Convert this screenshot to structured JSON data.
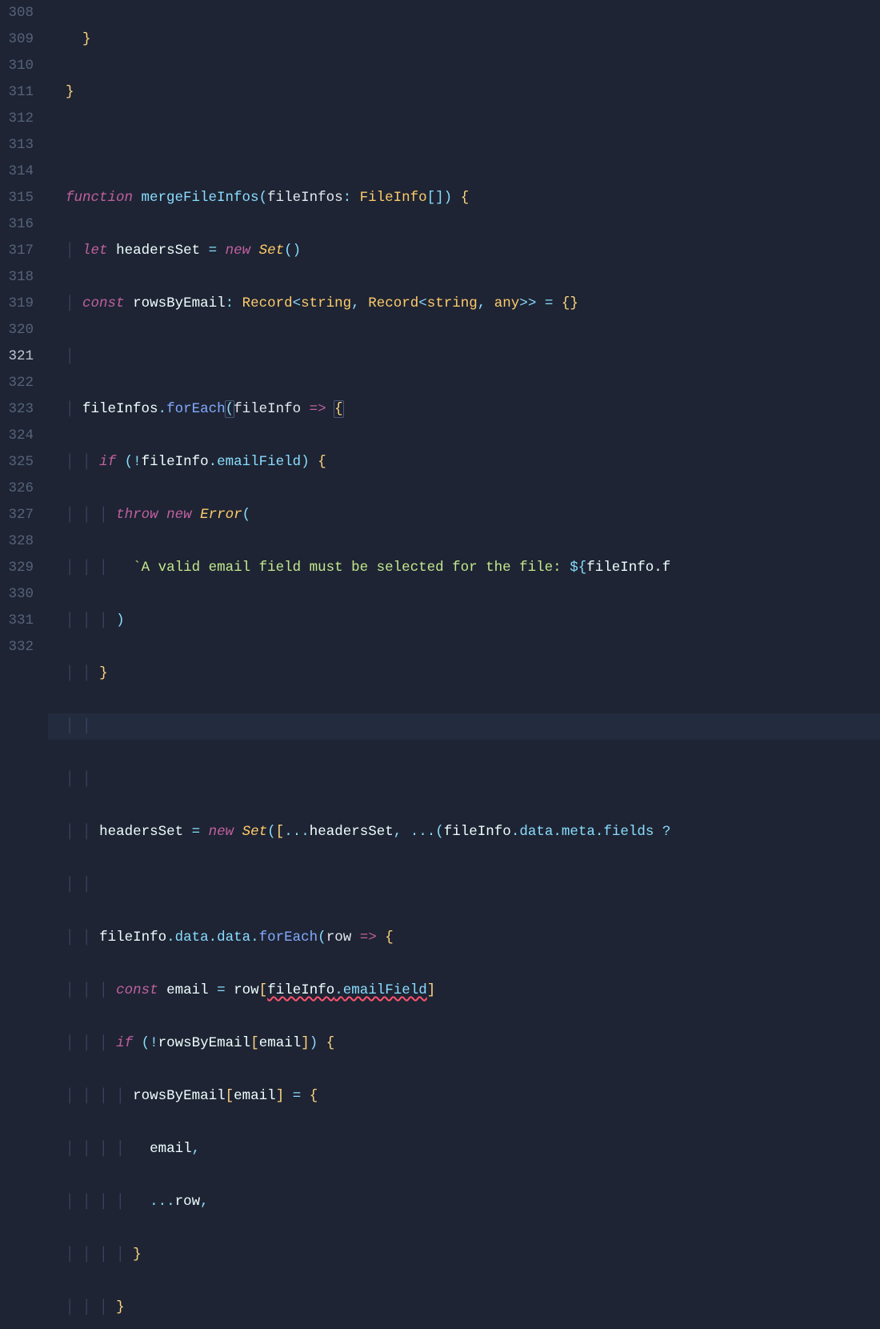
{
  "gutter": {
    "start": 308,
    "end": 332,
    "activeLine": 321
  },
  "tokens": {
    "function": "function",
    "let": "let",
    "const": "const",
    "new": "new",
    "if": "if",
    "throw": "throw",
    "arrow": "=>",
    "mergeFileInfos": "mergeFileInfos",
    "fileInfos": "fileInfos",
    "fileInfo": "fileInfo",
    "FileInfo": "FileInfo",
    "headersSet": "headersSet",
    "Set": "Set",
    "rowsByEmail": "rowsByEmail",
    "Record": "Record",
    "string": "string",
    "any": "any",
    "forEach": "forEach",
    "emailField": "emailField",
    "Error": "Error",
    "templateStr": "`A valid email field must be selected for the file: ",
    "templateOpen": "${",
    "fileInfoF": "fileInfo.f",
    "data": "data",
    "meta": "meta",
    "fields": "fields",
    "row": "row",
    "email": "email",
    "brace_open": "{",
    "brace_close": "}",
    "bracket_open": "[",
    "bracket_close": "]",
    "paren_open": "(",
    "paren_close": ")",
    "spread": "...",
    "nullish": "?",
    "eq": " = ",
    "eq2": "=",
    "colon": ":",
    "comma": ",",
    "dot": ".",
    "bang": "!",
    "angle_open": "<",
    "angle_close": ">",
    "empty_obj": "{}",
    "sq_brackets": "[]"
  }
}
